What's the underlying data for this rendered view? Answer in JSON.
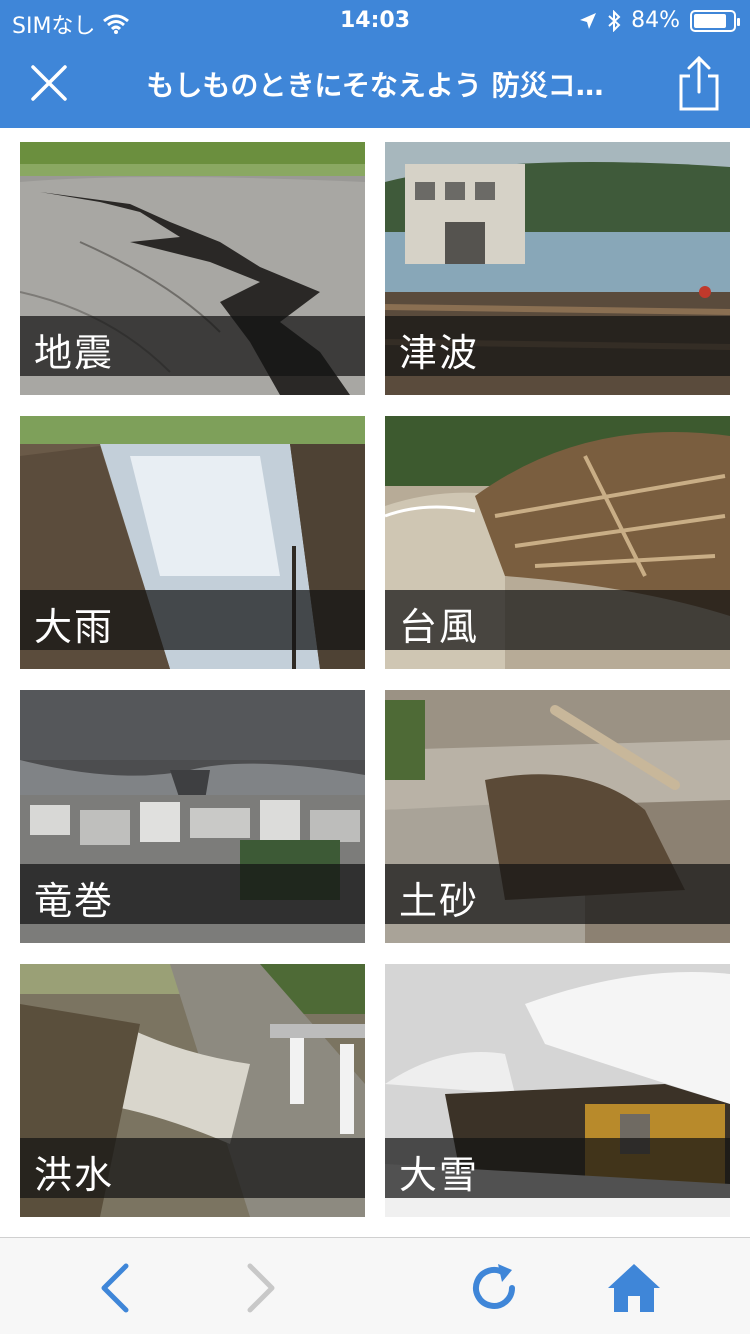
{
  "status_bar": {
    "carrier": "SIMなし",
    "time": "14:03",
    "battery_percent": "84%",
    "battery_level": 0.84,
    "icons": [
      "wifi-icon",
      "location-arrow-icon",
      "bluetooth-icon",
      "battery-icon"
    ]
  },
  "nav": {
    "title": "もしものときにそなえよう 防災コ…",
    "close_icon": "close-icon",
    "share_icon": "share-icon"
  },
  "tiles": [
    {
      "label": "地震",
      "scene": "earthquake"
    },
    {
      "label": "津波",
      "scene": "tsunami"
    },
    {
      "label": "大雨",
      "scene": "heavy-rain"
    },
    {
      "label": "台風",
      "scene": "typhoon"
    },
    {
      "label": "竜巻",
      "scene": "tornado"
    },
    {
      "label": "土砂",
      "scene": "landslide"
    },
    {
      "label": "洪水",
      "scene": "flood"
    },
    {
      "label": "大雪",
      "scene": "heavy-snow"
    }
  ],
  "toolbar": {
    "back_icon": "chevron-left-icon",
    "forward_icon": "chevron-right-icon",
    "reload_icon": "reload-icon",
    "home_icon": "home-icon",
    "accent": "#3f86d8",
    "disabled": "#c8c8c8"
  }
}
